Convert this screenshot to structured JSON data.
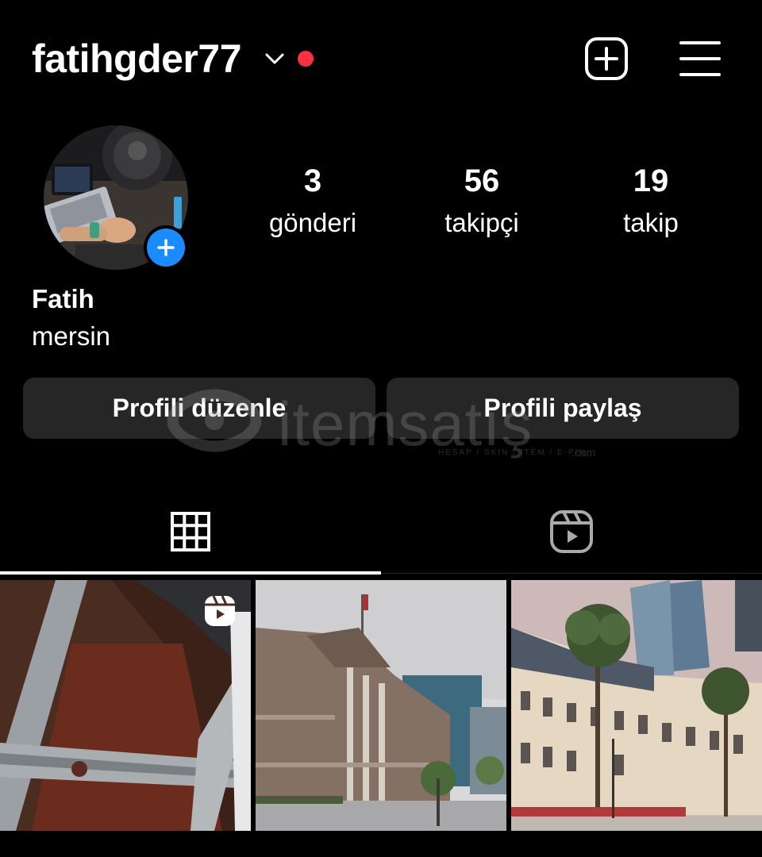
{
  "header": {
    "username": "fatihgder77",
    "icons": {
      "account_switch": "chevron-down-icon",
      "notification_dot": "red-dot",
      "new_post": "plus-square-icon",
      "menu": "hamburger-menu-icon"
    },
    "accent_color": "#ff3040"
  },
  "profile": {
    "display_name": "Fatih",
    "bio": "mersin",
    "add_story_icon": "plus-circle-icon",
    "add_story_color": "#1a8cff"
  },
  "stats": [
    {
      "value": "3",
      "label": "gönderi"
    },
    {
      "value": "56",
      "label": "takipçi"
    },
    {
      "value": "19",
      "label": "takip"
    }
  ],
  "buttons": {
    "edit_profile": "Profili düzenle",
    "share_profile": "Profili paylaş"
  },
  "watermark": {
    "brand": "itemsatış",
    "tagline": "HESAP / SKIN / ITEM / E-PIN",
    "suffix": ".com"
  },
  "tabs": [
    {
      "icon": "grid-icon",
      "selected": true
    },
    {
      "icon": "reels-icon",
      "selected": false
    }
  ],
  "posts": [
    {
      "type": "reel",
      "icon": "reels-icon"
    },
    {
      "type": "photo"
    },
    {
      "type": "photo"
    }
  ]
}
